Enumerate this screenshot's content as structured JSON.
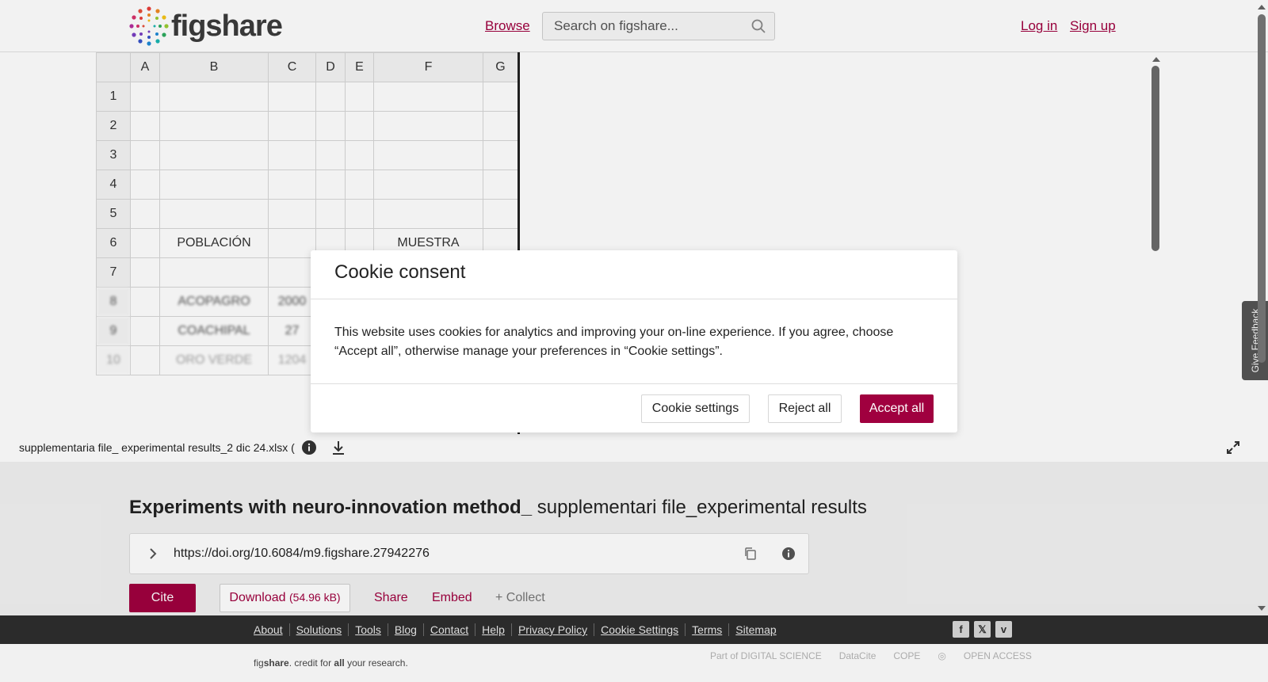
{
  "header": {
    "logo_text": "figshare",
    "browse": "Browse",
    "search_placeholder": "Search on figshare...",
    "login": "Log in",
    "signup": "Sign up"
  },
  "sheet": {
    "columns": [
      "A",
      "B",
      "C",
      "D",
      "E",
      "F",
      "G"
    ],
    "rows": [
      {
        "n": "1",
        "cells": [
          "",
          "",
          "",
          "",
          "",
          "",
          ""
        ]
      },
      {
        "n": "2",
        "cells": [
          "",
          "",
          "",
          "",
          "",
          "",
          ""
        ]
      },
      {
        "n": "3",
        "cells": [
          "",
          "",
          "",
          "",
          "",
          "",
          ""
        ]
      },
      {
        "n": "4",
        "cells": [
          "",
          "",
          "",
          "",
          "",
          "",
          ""
        ]
      },
      {
        "n": "5",
        "cells": [
          "",
          "",
          "",
          "",
          "",
          "",
          ""
        ]
      },
      {
        "n": "6",
        "cells": [
          "",
          "POBLACIÓN",
          "",
          "",
          "",
          "MUESTRA",
          ""
        ]
      },
      {
        "n": "7",
        "cells": [
          "",
          "",
          "",
          "",
          "",
          "",
          ""
        ]
      },
      {
        "n": "8",
        "cells": [
          "",
          "ACOPAGRO",
          "2000",
          "",
          "",
          "",
          ""
        ]
      },
      {
        "n": "9",
        "cells": [
          "",
          "COACHIPAL",
          "27",
          "",
          "",
          "",
          ""
        ]
      },
      {
        "n": "10",
        "cells": [
          "",
          "ORO VERDE",
          "1204",
          "",
          "",
          "",
          ""
        ]
      }
    ]
  },
  "file_bar": {
    "file_name": "supplementaria file_ experimental results_2 dic 24.xlsx ("
  },
  "feedback": "Give Feedback",
  "cookie": {
    "title": "Cookie consent",
    "body": "This website uses cookies for analytics and improving your on-line experience. If you agree, choose “Accept all”, otherwise manage your preferences in “Cookie settings”.",
    "settings": "Cookie settings",
    "reject": "Reject all",
    "accept": "Accept all"
  },
  "item": {
    "title_bold": "Experiments with neuro-innovation method_",
    "title_rest": " supplementari file_experimental results",
    "doi": "https://doi.org/10.6084/m9.figshare.27942276",
    "cite": "Cite",
    "download": "Download",
    "download_size": "(54.96 kB)",
    "share": "Share",
    "embed": "Embed",
    "collect": "+ Collect"
  },
  "footer": {
    "links": [
      "About",
      "Solutions",
      "Tools",
      "Blog",
      "Contact",
      "Help",
      "Privacy Policy",
      "Cookie Settings",
      "Terms",
      "Sitemap"
    ],
    "tagline_pre": "fig",
    "tagline_bold": "share",
    "tagline_mid": ". credit for ",
    "tagline_all": "all",
    "tagline_end": " your research.",
    "partners": [
      "Part of DIGITAL SCIENCE",
      "DataCite",
      "COPE",
      "",
      "OPEN ACCESS"
    ]
  },
  "colors": {
    "accent": "#a0003f",
    "footer_dark": "#2b2b2b"
  }
}
